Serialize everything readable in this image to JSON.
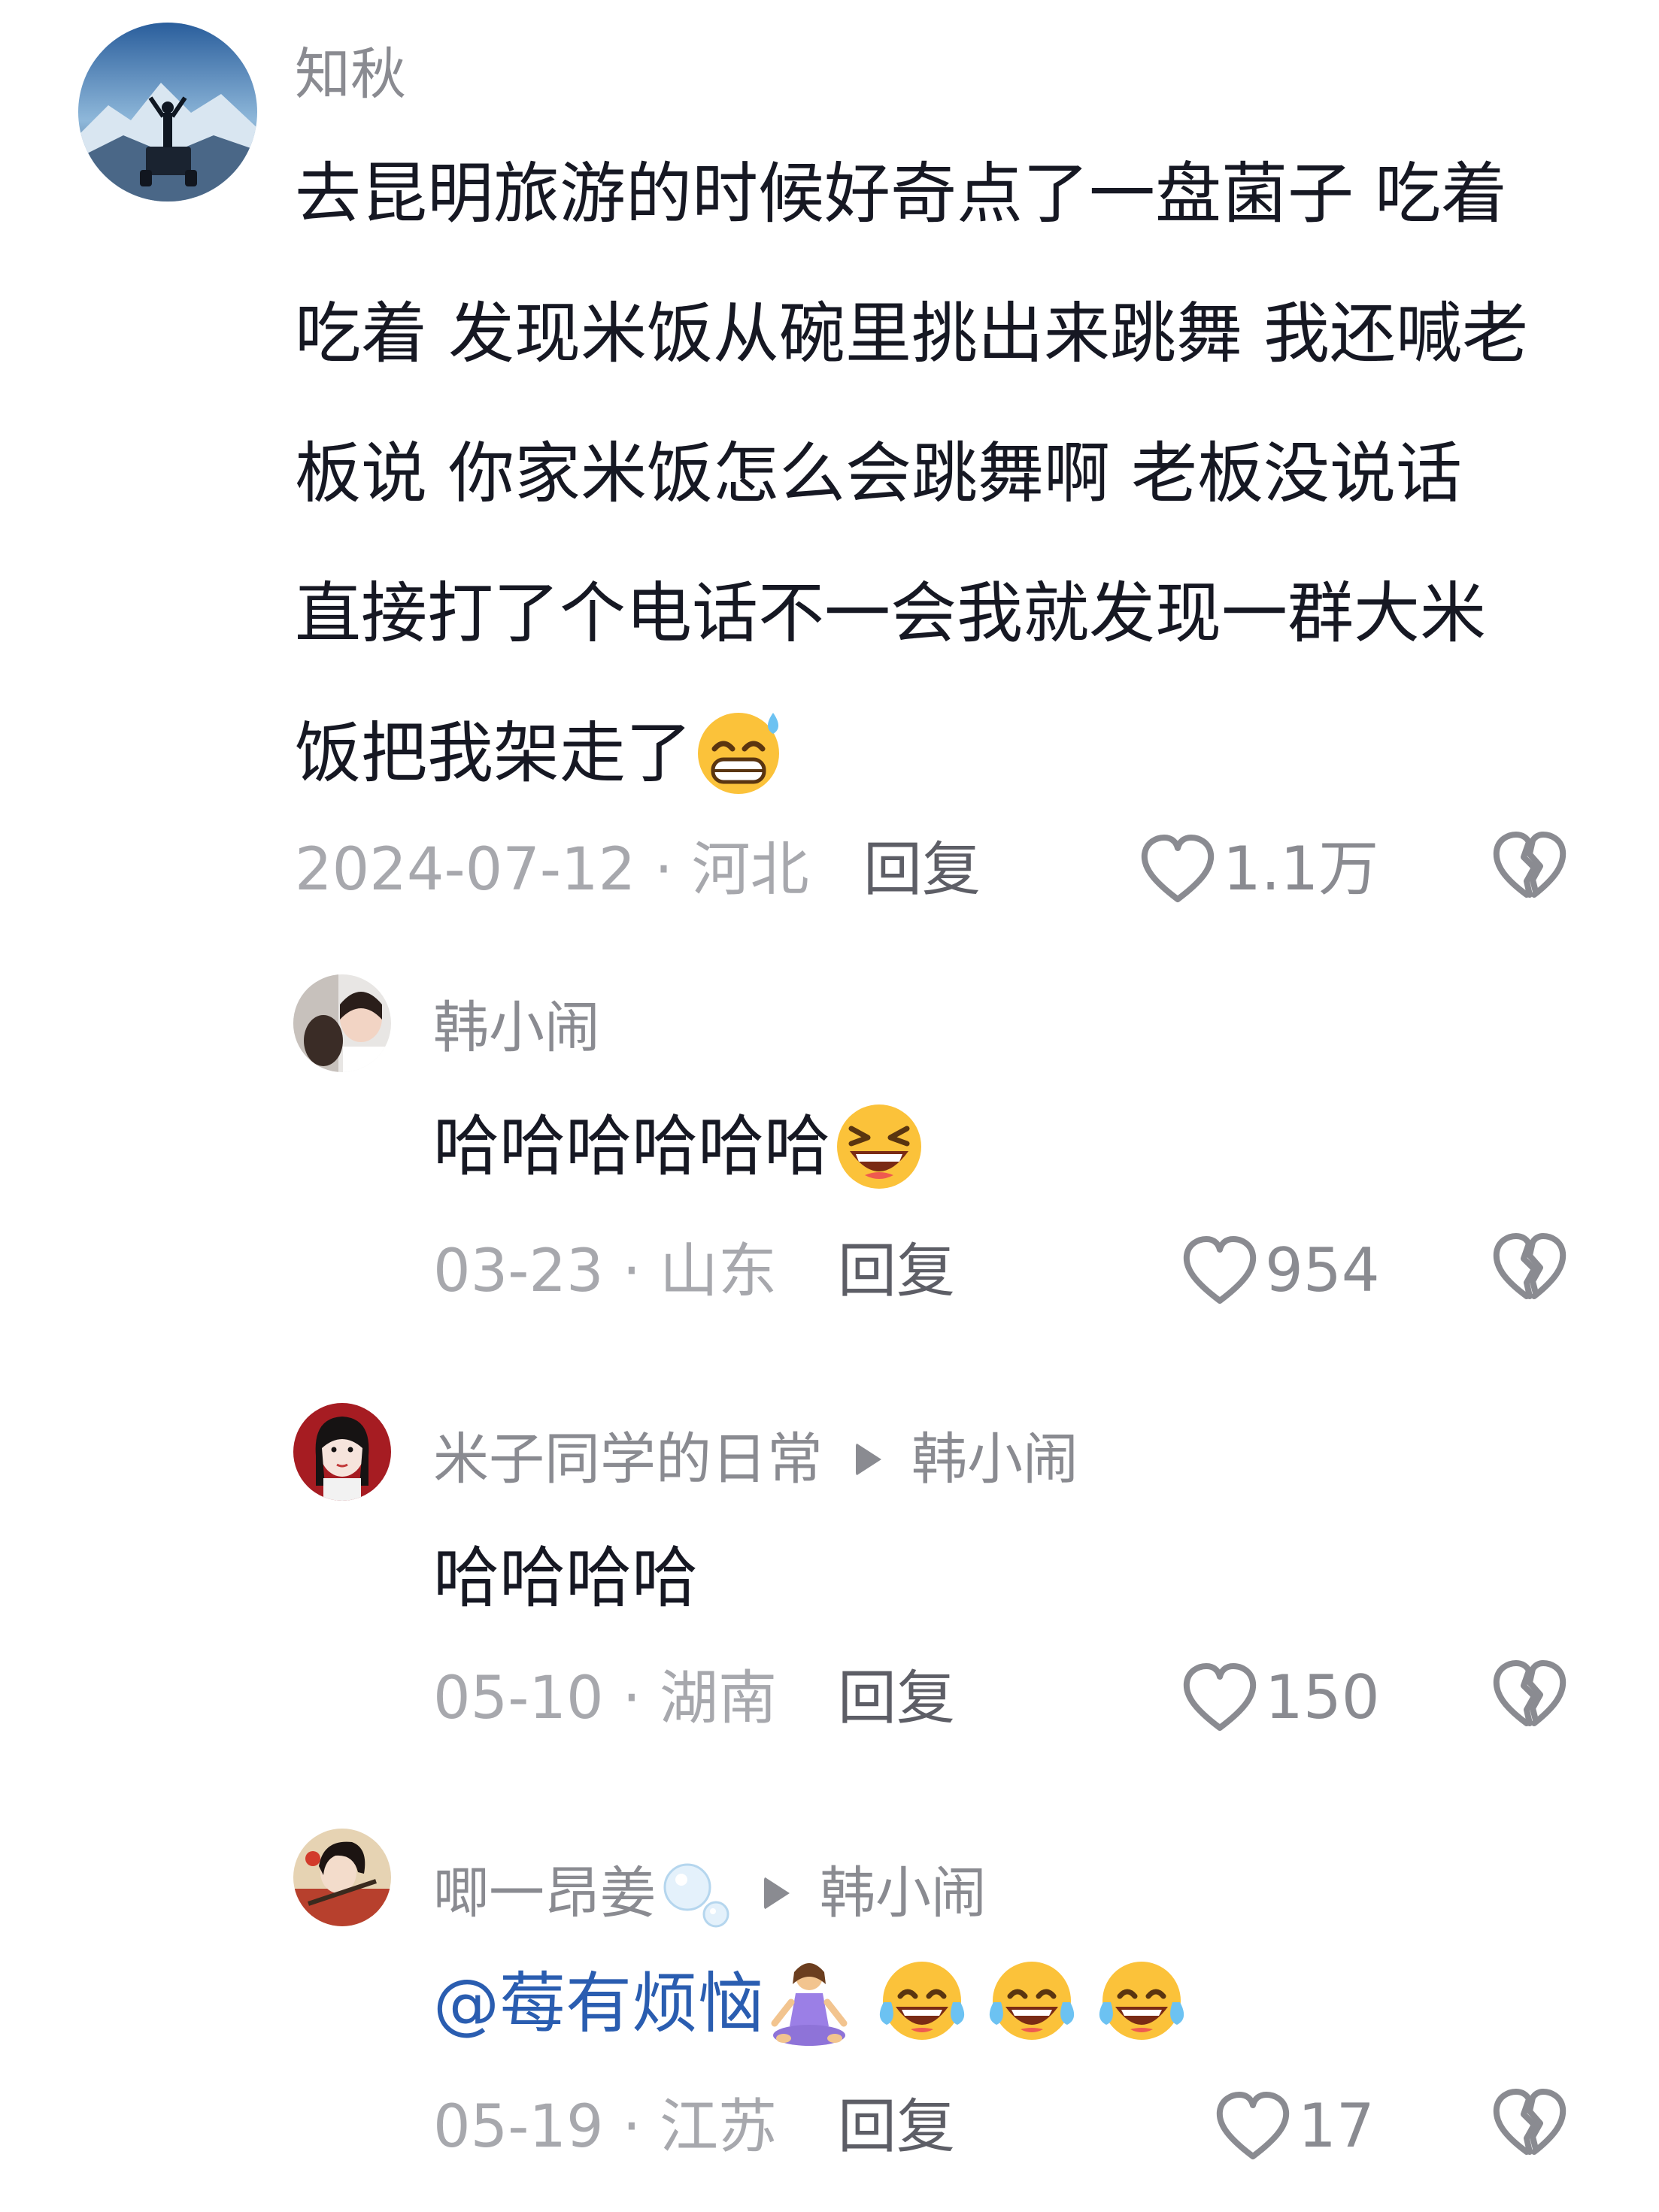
{
  "comments": [
    {
      "username": "知秋",
      "lines": [
        "去昆明旅游的时候好奇点了一盘菌子 吃着",
        "吃着 发现米饭从碗里挑出来跳舞 我还喊老",
        "板说 你家米饭怎么会跳舞啊   老板没说话",
        "直接打了个电话不一会我就发现一群大米",
        "饭把我架走了"
      ],
      "emoji": "grin-sweat-emoji",
      "meta": "2024-07-12 · 河北",
      "reply_label": "回复",
      "likes": "1.1万"
    },
    {
      "username": "韩小闹",
      "text": "哈哈哈哈哈哈",
      "emoji": "laughing-emoji",
      "meta": "03-23 · 山东",
      "reply_label": "回复",
      "likes": "954"
    },
    {
      "username": "米子同学的日常",
      "reply_to": "韩小闹",
      "text": "哈哈哈哈",
      "meta": "05-10 · 湖南",
      "reply_label": "回复",
      "likes": "150"
    },
    {
      "username": "唧一昂姜",
      "username_emoji": "bubbles-emoji",
      "reply_to": "韩小闹",
      "mention": "@莓有烦恼",
      "emojis": [
        "meditating-woman-emoji",
        "tears-of-joy-emoji",
        "tears-of-joy-emoji",
        "tears-of-joy-emoji"
      ],
      "meta": "05-19 · 江苏",
      "reply_label": "回复",
      "likes": "17"
    }
  ],
  "colors": {
    "text": "#161823",
    "username": "#8a8b91",
    "meta": "#a7a8ad",
    "reply": "#5d5e66",
    "mention": "#2a5db0",
    "icon": "#8a8b91"
  }
}
